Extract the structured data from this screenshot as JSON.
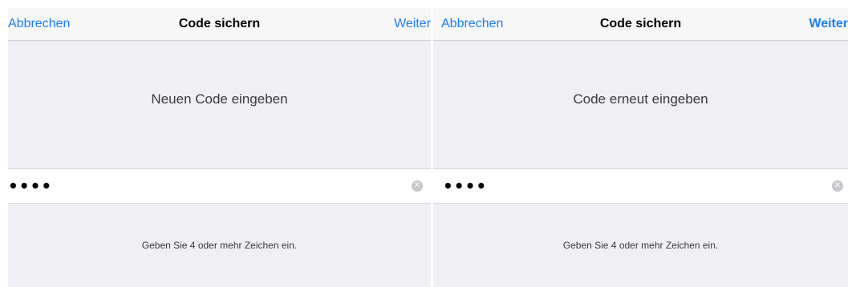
{
  "screens": [
    {
      "nav": {
        "cancel": "Abbrechen",
        "title": "Code sichern",
        "next": "Weiter"
      },
      "prompt": "Neuen Code eingeben",
      "field": {
        "value": "••••",
        "clear_icon": "clear-icon"
      },
      "hint": "Geben Sie 4 oder mehr Zeichen ein."
    },
    {
      "nav": {
        "cancel": "Abbrechen",
        "title": "Code sichern",
        "next": "Weiter"
      },
      "prompt": "Code erneut eingeben",
      "field": {
        "value": "••••",
        "clear_icon": "clear-icon"
      },
      "hint": "Geben Sie 4 oder mehr Zeichen ein."
    }
  ],
  "colors": {
    "accent": "#1c7ef3",
    "background": "#efeff4",
    "navbar": "#f7f7f8",
    "field": "#ffffff",
    "clear_button": "#c7c7cc"
  }
}
